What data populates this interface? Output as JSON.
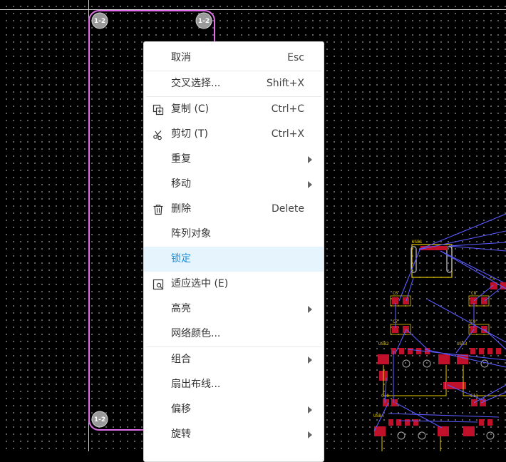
{
  "canvas": {
    "colors": {
      "background": "#000000",
      "grid_dot": "#7a7a7a",
      "outline": "#e070e8",
      "ratsnest": "#5a5aff",
      "pad": "#c0102a",
      "silk": "#e6c800"
    },
    "pad_labels": [
      "1-2",
      "1-2",
      "1-2"
    ],
    "component_labels": [
      "USB1",
      "C6",
      "C8",
      "C7",
      "C9",
      "C3",
      "USB2",
      "USB3",
      "C10",
      "USB4",
      "C11"
    ]
  },
  "menu": {
    "items": [
      {
        "label": "取消",
        "shortcut": "Esc",
        "icon": "",
        "submenu": false
      },
      {
        "label": "交叉选择...",
        "shortcut": "Shift+X",
        "icon": "",
        "submenu": false
      },
      {
        "label": "复制 (C)",
        "shortcut": "Ctrl+C",
        "icon": "copy-icon",
        "submenu": false
      },
      {
        "label": "剪切 (T)",
        "shortcut": "Ctrl+X",
        "icon": "scissors-icon",
        "submenu": false
      },
      {
        "label": "重复",
        "shortcut": "",
        "icon": "",
        "submenu": true
      },
      {
        "label": "移动",
        "shortcut": "",
        "icon": "",
        "submenu": true
      },
      {
        "label": "删除",
        "shortcut": "Delete",
        "icon": "trash-icon",
        "submenu": false
      },
      {
        "label": "阵列对象",
        "shortcut": "",
        "icon": "",
        "submenu": false
      },
      {
        "label": "锁定",
        "shortcut": "",
        "icon": "",
        "submenu": false,
        "hovered": true
      },
      {
        "label": "适应选中 (E)",
        "shortcut": "",
        "icon": "zoom-fit-icon",
        "submenu": false
      },
      {
        "label": "高亮",
        "shortcut": "",
        "icon": "",
        "submenu": true
      },
      {
        "label": "网络颜色...",
        "shortcut": "",
        "icon": "",
        "submenu": false
      },
      {
        "label": "组合",
        "shortcut": "",
        "icon": "",
        "submenu": true
      },
      {
        "label": "扇出布线...",
        "shortcut": "",
        "icon": "",
        "submenu": false
      },
      {
        "label": "偏移",
        "shortcut": "",
        "icon": "",
        "submenu": true
      },
      {
        "label": "旋转",
        "shortcut": "",
        "icon": "",
        "submenu": true
      }
    ],
    "highlight_color": "#e6f4fd",
    "highlight_text_color": "#1f8fd6"
  }
}
